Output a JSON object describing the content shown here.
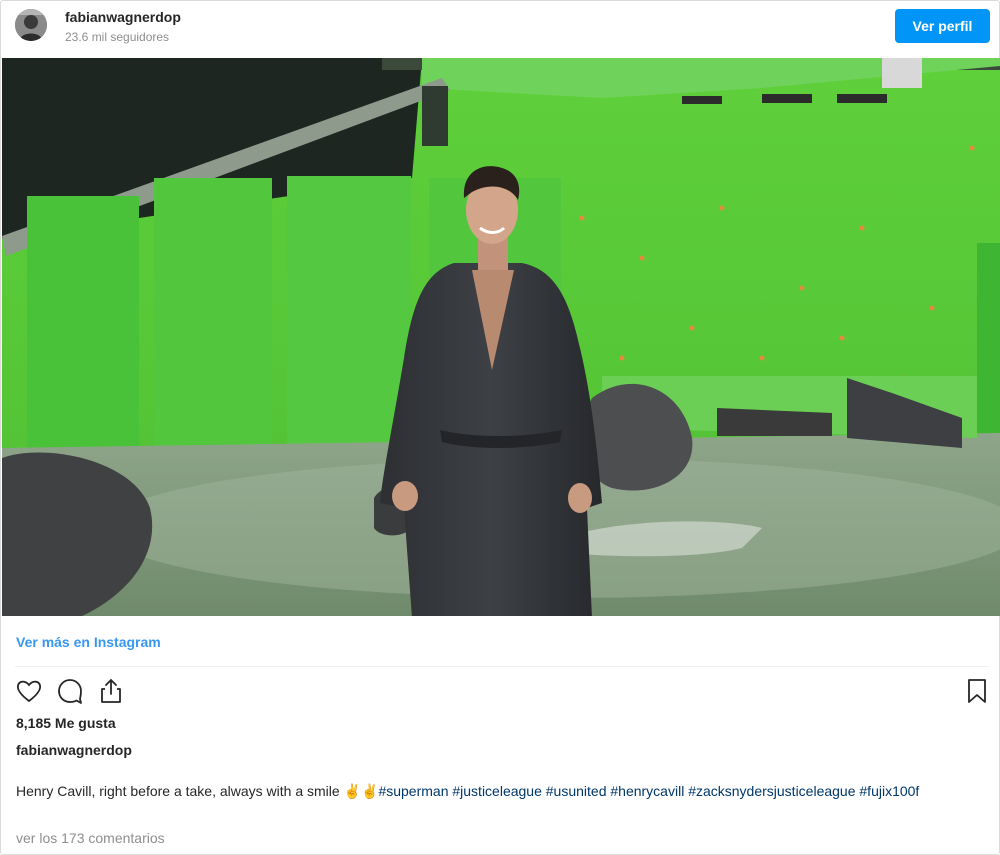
{
  "header": {
    "username": "fabianwagnerdop",
    "followers": "23.6 mil seguidores",
    "profile_button": "Ver perfil"
  },
  "post": {
    "image_alt": "Henry Cavill in a dark robe on a green screen set",
    "view_more": "Ver más en Instagram",
    "likes": "8,185 Me gusta",
    "caption_user": "fabianwagnerdop",
    "caption_text": "Henry Cavill, right before a take, always with a smile ✌✌",
    "caption_tags": "#superman #justiceleague #usunited #henrycavill #zacksnydersjusticeleague #fujix100f",
    "comments_link": "ver los 173 comentarios"
  },
  "icons": {
    "like": "heart-icon",
    "comment": "comment-icon",
    "share": "share-icon",
    "save": "bookmark-icon"
  },
  "colors": {
    "accent": "#0095f6",
    "link": "#3897f0",
    "green_screen": "#5ecb3a"
  }
}
